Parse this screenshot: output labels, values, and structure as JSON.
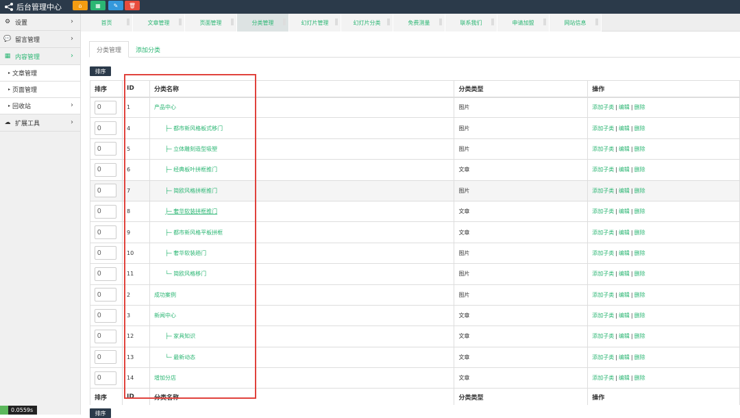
{
  "app": {
    "title": "后台管理中心"
  },
  "colors": {
    "accent": "#2bb673",
    "topbar": "#2b3a4a",
    "highlight_box": "#e0403a"
  },
  "quick_buttons": [
    {
      "icon": "home-icon",
      "color": "#f39c12"
    },
    {
      "icon": "grid-icon",
      "color": "#2bb673"
    },
    {
      "icon": "pencil-icon",
      "color": "#3498db"
    },
    {
      "icon": "trash-icon",
      "color": "#e74c3c"
    }
  ],
  "sidebar": {
    "items": [
      {
        "label": "设置",
        "icon": "gear-icon"
      },
      {
        "label": "留言管理",
        "icon": "chat-icon"
      },
      {
        "label": "内容管理",
        "icon": "grid-icon"
      },
      {
        "label": "扩展工具",
        "icon": "cloud-icon"
      }
    ],
    "subitems": [
      {
        "label": "文章管理"
      },
      {
        "label": "页面管理"
      },
      {
        "label": "回收站"
      }
    ]
  },
  "timer": "0.0559s",
  "tabs": [
    "首页",
    "文章管理",
    "页面管理",
    "分类管理",
    "幻灯片管理",
    "幻灯片分类",
    "免费测量",
    "联系我们",
    "申请加盟",
    "网站信息"
  ],
  "subtabs": [
    "分类管理",
    "添加分类"
  ],
  "sort_button": "排序",
  "table": {
    "headers": [
      "排序",
      "ID",
      "分类名称",
      "分类类型",
      "操作"
    ],
    "footer_headers": [
      "排序",
      "ID",
      "分类名称",
      "分类类型",
      "操作"
    ],
    "rows": [
      {
        "sort": "0",
        "id": "1",
        "name": "产品中心",
        "type": "图片"
      },
      {
        "sort": "0",
        "id": "4",
        "name": "├─ 都市新风格板式移门",
        "type": "图片"
      },
      {
        "sort": "0",
        "id": "5",
        "name": "├─ 立体雕刻造型吸塑",
        "type": "图片"
      },
      {
        "sort": "0",
        "id": "6",
        "name": "├─ 经典板叶拼框推门",
        "type": "文章"
      },
      {
        "sort": "0",
        "id": "7",
        "name": "├─ 简欧风格拼框推门",
        "type": "图片"
      },
      {
        "sort": "0",
        "id": "8",
        "name": "├─ 奢华软装拼框推门",
        "type": "文章"
      },
      {
        "sort": "0",
        "id": "9",
        "name": "├─ 都市新风格平板拼框",
        "type": "文章"
      },
      {
        "sort": "0",
        "id": "10",
        "name": "├─ 奢华软装趟门",
        "type": "图片"
      },
      {
        "sort": "0",
        "id": "11",
        "name": "└─ 简欧风格移门",
        "type": "图片"
      },
      {
        "sort": "0",
        "id": "2",
        "name": "成功案例",
        "type": "图片"
      },
      {
        "sort": "0",
        "id": "3",
        "name": "新闻中心",
        "type": "文章"
      },
      {
        "sort": "0",
        "id": "12",
        "name": "├─ 家具知识",
        "type": "文章"
      },
      {
        "sort": "0",
        "id": "13",
        "name": "└─ 最新动态",
        "type": "文章"
      },
      {
        "sort": "0",
        "id": "14",
        "name": "增加分店",
        "type": "文章"
      }
    ],
    "ops": {
      "add_child": "添加子类",
      "edit": "编辑",
      "delete": "删除",
      "sep": "|"
    }
  }
}
